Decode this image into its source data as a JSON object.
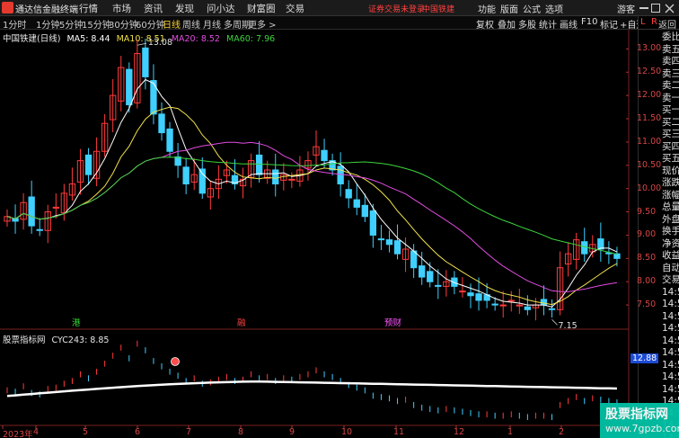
{
  "titlebar": {
    "app_title": "通达信金融终端",
    "menus": [
      "行情",
      "市场",
      "资讯",
      "发现",
      "问小达",
      "财富圈",
      "交易"
    ],
    "notice": "证券交易未登录",
    "stock": "中国铁建",
    "right_menus": [
      "功能",
      "版面",
      "公式",
      "选项",
      "游客"
    ]
  },
  "toolbar": {
    "periods": [
      "1分时",
      "1分钟",
      "5分钟",
      "15分钟",
      "30分钟",
      "60分钟",
      "日线",
      "周线",
      "月线",
      "多周期",
      "更多 >"
    ],
    "active_period": "日线",
    "tools": [
      "复权",
      "叠加",
      "多股",
      "统计",
      "画线",
      "F10",
      "标记",
      "+自选",
      "返回"
    ]
  },
  "side_panel": {
    "controls": [
      "L",
      "R"
    ],
    "rows": [
      "委比",
      "卖五",
      "卖四",
      "卖三",
      "卖二",
      "卖一",
      "买一",
      "买二",
      "买三",
      "买四",
      "买五",
      "现价",
      "涨跌",
      "涨幅",
      "总量",
      "外盘",
      "换手",
      "净资",
      "收益",
      "自动",
      "交易",
      "14:56",
      "14:56",
      "14:56",
      "14:56",
      "14:56",
      "14:56",
      "14:56",
      "14:56",
      "14:56",
      "14:56",
      "14:56",
      "14:56",
      "14:56"
    ]
  },
  "main_chart": {
    "title": "中国铁建(日线)",
    "ma_labels": [
      {
        "text": "MA5: 8.44",
        "color": "#ffffff"
      },
      {
        "text": "MA10: 8.51",
        "color": "#f2e24a"
      },
      {
        "text": "MA20: 8.52",
        "color": "#e14ce0"
      },
      {
        "text": "MA60: 7.96",
        "color": "#3cd43c"
      }
    ],
    "high_label": "13.08",
    "low_label": "7.15",
    "event_markers": [
      {
        "text": "港",
        "color": "#33dd33"
      },
      {
        "text": "融",
        "color": "#ff4040"
      },
      {
        "text": "预财",
        "color": "#ff55ff"
      }
    ]
  },
  "sub_chart": {
    "title": "股票指标网",
    "indicator": "CYC243: 8.85",
    "highlight_value": "12.88"
  },
  "watermark": {
    "line1": "股票指标网",
    "line2": "www.7gpzb.com"
  },
  "chart_data": {
    "type": "candlestick",
    "title": "中国铁建(日线)",
    "ylim": [
      7.0,
      13.2
    ],
    "y_ticks": [
      13.0,
      12.5,
      12.0,
      11.5,
      11.0,
      10.5,
      10.0,
      9.5,
      9.0,
      8.5,
      8.0,
      7.5
    ],
    "x_labels": [
      "2023年",
      "4",
      "5",
      "6",
      "7",
      "8",
      "9",
      "10",
      "11",
      "12",
      "1",
      "2"
    ],
    "close_series": [
      9.4,
      9.3,
      9.7,
      9.2,
      9.1,
      9.5,
      9.6,
      9.9,
      10.1,
      10.6,
      10.3,
      10.8,
      11.4,
      12.0,
      12.6,
      11.8,
      12.9,
      12.4,
      11.6,
      11.2,
      10.8,
      10.5,
      10.1,
      10.3,
      9.9,
      10.0,
      10.2,
      10.4,
      10.1,
      10.2,
      10.6,
      10.3,
      10.4,
      10.1,
      10.3,
      10.2,
      10.4,
      10.6,
      10.9,
      10.6,
      10.4,
      10.1,
      9.8,
      9.6,
      9.4,
      9.0,
      8.9,
      8.8,
      8.6,
      8.7,
      8.3,
      8.1,
      8.0,
      7.9,
      8.0,
      7.9,
      7.8,
      7.7,
      7.6,
      7.6,
      7.5,
      7.5,
      7.6,
      7.5,
      7.4,
      7.5,
      7.5,
      7.4,
      8.3,
      8.6,
      8.9,
      8.6,
      8.8,
      8.7,
      8.6,
      8.5
    ],
    "ma5": 8.44,
    "ma10": 8.51,
    "ma20": 8.52,
    "ma60": 7.96,
    "sub_ticks": [
      "12.88"
    ],
    "ma_colors": {
      "ma5": "#ffffff",
      "ma10": "#f2e24a",
      "ma20": "#e14ce0",
      "ma60": "#3cd43c"
    }
  }
}
